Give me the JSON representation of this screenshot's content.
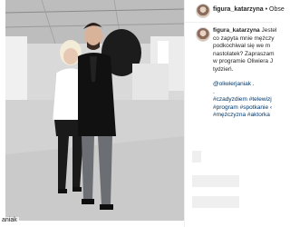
{
  "post": {
    "username": "figura_katarzyna",
    "header_separator": "•",
    "follow_label": "Obse",
    "photo_caption": "aniak"
  },
  "comment": {
    "author": "figura_katarzyna",
    "line1_rest": " Jestel",
    "line2": "co zapyta mnie mężczy",
    "line3": "podkochiwał się we m",
    "line4": "nastolatek? Zapraszam",
    "line5": "w programie Oliwiera J",
    "line6": "tydzień.",
    "mention": "@oliwierjaniak .",
    "dot1": ".",
    "tags1": "#czadyzdiem #telewizj",
    "tags2": "#program #spotkanie ‹",
    "tags3": "#mężczyzna #aktorka"
  }
}
